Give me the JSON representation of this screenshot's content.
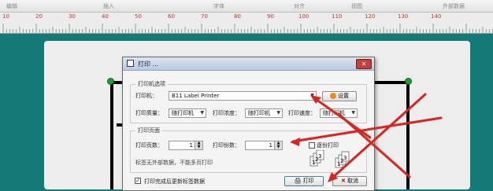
{
  "ribbon": {
    "tabs": [
      "编辑",
      "插入",
      "字体",
      "对齐",
      "视图",
      "外部数据"
    ]
  },
  "ruler": {
    "numbers": [
      "10",
      "20",
      "30",
      "40",
      "50",
      "60",
      "70",
      "80",
      "90",
      "100",
      "110",
      "120",
      "130",
      "140"
    ]
  },
  "dialog": {
    "title": "打印 ...",
    "close_symbol": "✕",
    "printer_group": {
      "legend": "打印机选项",
      "printer_label": "打印机：",
      "printer_value": "B11 Label Printer",
      "settings_button": "设置",
      "quality_label": "打印质量：",
      "quality_value": "随打印机",
      "density_label": "打印浓度：",
      "density_value": "随打印机",
      "speed_label": "打印速度：",
      "speed_value": "随打印机"
    },
    "page_group": {
      "legend": "打印页面",
      "pages_label": "打印页数：",
      "pages_value": "1",
      "copies_label": "打印份数：",
      "copies_value": "1",
      "collate_label": "逐份打印",
      "note": "标签无外部数据，不能多页打印"
    },
    "refresh_checkbox_label": "打印完成后更新标签数据",
    "refresh_checked": true,
    "print_button": "打印",
    "cancel_button": "取消"
  },
  "colors": {
    "background": "#137a78",
    "arrow": "#d7261e",
    "handle": "#1e9e2f"
  }
}
